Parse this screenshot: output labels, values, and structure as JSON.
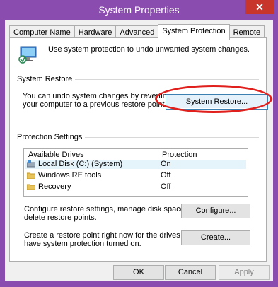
{
  "window": {
    "title": "System Properties",
    "close_glyph": "✕"
  },
  "tabs": [
    {
      "label": "Computer Name"
    },
    {
      "label": "Hardware"
    },
    {
      "label": "Advanced"
    },
    {
      "label": "System Protection"
    },
    {
      "label": "Remote"
    }
  ],
  "intro": {
    "text": "Use system protection to undo unwanted system changes."
  },
  "system_restore": {
    "group_title": "System Restore",
    "description_line1": "You can undo system changes by reverting",
    "description_line2": "your computer to a previous restore point.",
    "button_label": "System Restore..."
  },
  "protection_settings": {
    "group_title": "Protection Settings",
    "col_drives": "Available Drives",
    "col_protection": "Protection",
    "drives": [
      {
        "name": "Local Disk (C:) (System)",
        "protection": "On"
      },
      {
        "name": "Windows RE tools",
        "protection": "Off"
      },
      {
        "name": "Recovery",
        "protection": "Off"
      }
    ],
    "configure_text_line1": "Configure restore settings, manage disk space, and",
    "configure_text_line2": "delete restore points.",
    "configure_button": "Configure...",
    "create_text_line1": "Create a restore point right now for the drives that",
    "create_text_line2": "have system protection turned on.",
    "create_button": "Create..."
  },
  "footer": {
    "ok": "OK",
    "cancel": "Cancel",
    "apply": "Apply"
  }
}
